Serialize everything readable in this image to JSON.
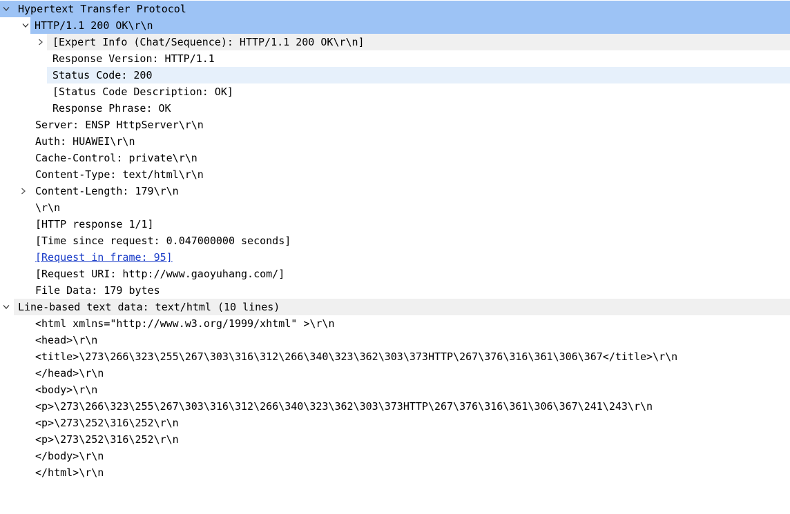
{
  "tree": {
    "http_section": "Hypertext Transfer Protocol",
    "status_line": "HTTP/1.1 200 OK\\r\\n",
    "expert_info": "[Expert Info (Chat/Sequence): HTTP/1.1 200 OK\\r\\n]",
    "response_version": "Response Version: HTTP/1.1",
    "status_code": "Status Code: 200",
    "status_code_description": "[Status Code Description: OK]",
    "response_phrase": "Response Phrase: OK",
    "server": "Server: ENSP HttpServer\\r\\n",
    "auth": "Auth: HUAWEI\\r\\n",
    "cache_control": "Cache-Control: private\\r\\n",
    "content_type": "Content-Type: text/html\\r\\n",
    "content_length": "Content-Length: 179\\r\\n",
    "crlf": "\\r\\n",
    "http_response": "[HTTP response 1/1]",
    "time_since_request": "[Time since request: 0.047000000 seconds]",
    "request_in_frame": "[Request in frame: 95]",
    "request_uri": "[Request URI: http://www.gaoyuhang.com/]",
    "file_data": "File Data: 179 bytes",
    "line_based_section": "Line-based text data: text/html (10 lines)",
    "lines": [
      "<html xmlns=\"http://www.w3.org/1999/xhtml\" >\\r\\n",
      "<head>\\r\\n",
      "<title>\\273\\266\\323\\255\\267\\303\\316\\312\\266\\340\\323\\362\\303\\373HTTP\\267\\376\\316\\361\\306\\367</title>\\r\\n",
      "</head>\\r\\n",
      "<body>\\r\\n",
      "<p>\\273\\266\\323\\255\\267\\303\\316\\312\\266\\340\\323\\362\\303\\373HTTP\\267\\376\\316\\361\\306\\367\\241\\243\\r\\n",
      "<p>\\273\\252\\316\\252\\r\\n",
      "<p>\\273\\252\\316\\252\\r\\n",
      "</body>\\r\\n",
      "</html>\\r\\n"
    ]
  },
  "icons": {
    "expanded": "chevron-down-icon",
    "collapsed": "chevron-right-icon"
  },
  "colors": {
    "selection": "#9dc3f5",
    "selection_light": "#e6f0fb",
    "shaded_row": "#f0f0f0",
    "link": "#1a3cc8"
  }
}
